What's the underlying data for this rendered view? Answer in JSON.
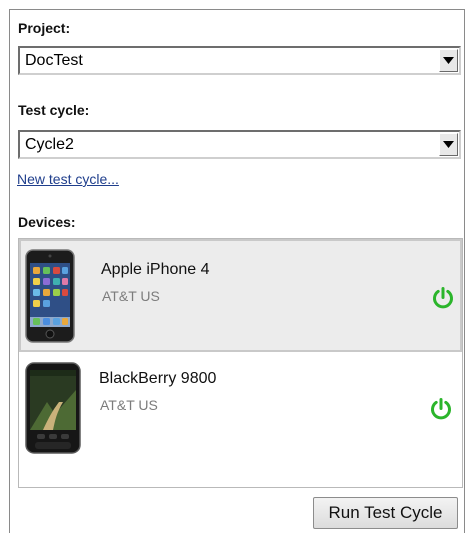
{
  "project": {
    "label": "Project:",
    "selected": "DocTest"
  },
  "test_cycle": {
    "label": "Test cycle:",
    "selected": "Cycle2",
    "new_link": "New test cycle..."
  },
  "devices": {
    "label": "Devices:",
    "items": [
      {
        "name": "Apple iPhone 4",
        "carrier": "AT&T US",
        "status_icon": "power-icon",
        "selected": true
      },
      {
        "name": "BlackBerry 9800",
        "carrier": "AT&T US",
        "status_icon": "power-icon",
        "selected": false
      }
    ]
  },
  "actions": {
    "run_label": "Run Test Cycle"
  },
  "colors": {
    "power_on": "#2bb52b",
    "link": "#1f3e8c"
  }
}
